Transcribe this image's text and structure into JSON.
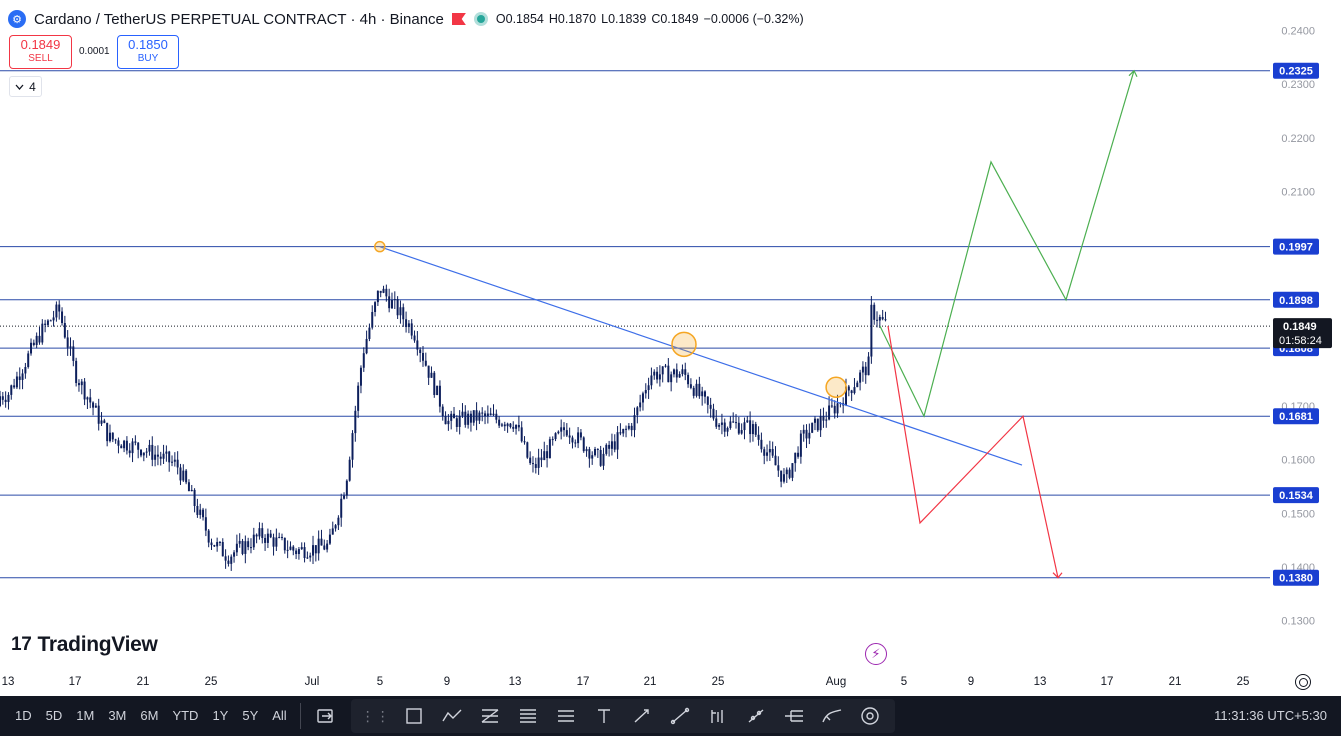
{
  "header": {
    "title": "Cardano / TetherUS PERPETUAL CONTRACT · 4h · Binance",
    "ohlc": {
      "open": "O0.1854",
      "high": "H0.1870",
      "low": "L0.1839",
      "close": "C0.1849",
      "change": "−0.0006 (−0.32%)"
    }
  },
  "trade": {
    "sell_price": "0.1849",
    "sell_label": "SELL",
    "spread": "0.0001",
    "buy_price": "0.1850",
    "buy_label": "BUY"
  },
  "indicators_count": "4",
  "branding": {
    "logo_text": "TradingView"
  },
  "bottom_bar": {
    "periods": [
      "1D",
      "5D",
      "1M",
      "3M",
      "6M",
      "YTD",
      "1Y",
      "5Y",
      "All"
    ],
    "clock": "11:31:36 UTC+5:30"
  },
  "icons": [
    "coin-icon",
    "flag-icon",
    "status-dot-icon",
    "chevron-down-icon",
    "bolt-icon",
    "axis-settings-icon"
  ],
  "colors": {
    "level_line": "#2a4aa8",
    "trend_line": "#3d6ee8",
    "bull_path": "#4caf50",
    "bear_path": "#f23645",
    "candle": "#0d1f5c",
    "price_tag": "#1a3fd1",
    "marker": "#f5a623"
  },
  "chart_data": {
    "type": "candlestick",
    "symbol": "ADAUSDT.P",
    "interval": "4h",
    "y_ticks": [
      "0.2400",
      "0.2300",
      "0.2200",
      "0.2100",
      "0.1900",
      "0.1700",
      "0.1600",
      "0.1500",
      "0.1400",
      "0.1300"
    ],
    "x_ticks": [
      "13",
      "17",
      "21",
      "25",
      "Jul",
      "5",
      "9",
      "13",
      "17",
      "21",
      "25",
      "Aug",
      "5",
      "9",
      "13",
      "17",
      "21",
      "25"
    ],
    "horizontal_levels": [
      "0.2325",
      "0.1997",
      "0.1898",
      "0.1808",
      "0.1681",
      "0.1534",
      "0.1380"
    ],
    "current_price": "0.1849",
    "countdown": "01:58:24",
    "ylim": [
      0.1262,
      0.2427
    ],
    "trendline": {
      "from": {
        "x": "Jul 5",
        "y": 0.1997
      },
      "to": {
        "x": "Aug 12",
        "y": 0.159
      }
    },
    "bullish_projection": [
      0.1849,
      0.1681,
      0.2155,
      0.1898,
      0.2325
    ],
    "bearish_projection": [
      0.1849,
      0.1482,
      0.1681,
      0.138
    ],
    "markers": [
      {
        "x": "Jul 5",
        "y": 0.1997
      },
      {
        "x": "Jul 23",
        "y": 0.1815
      },
      {
        "x": "Aug 1",
        "y": 0.1735
      }
    ],
    "price_path": [
      {
        "x": "Jun 10",
        "price": 0.17
      },
      {
        "x": "Jun 13",
        "price": 0.1722
      },
      {
        "x": "Jun 15",
        "price": 0.184
      },
      {
        "x": "Jun 16",
        "price": 0.188
      },
      {
        "x": "Jun 17",
        "price": 0.176
      },
      {
        "x": "Jun 19",
        "price": 0.164
      },
      {
        "x": "Jun 21",
        "price": 0.162
      },
      {
        "x": "Jun 23",
        "price": 0.159
      },
      {
        "x": "Jun 25",
        "price": 0.145
      },
      {
        "x": "Jun 26",
        "price": 0.142
      },
      {
        "x": "Jun 28",
        "price": 0.146
      },
      {
        "x": "Jun 30",
        "price": 0.143
      },
      {
        "x": "Jul 2",
        "price": 0.144
      },
      {
        "x": "Jul 3",
        "price": 0.156
      },
      {
        "x": "Jul 4",
        "price": 0.18
      },
      {
        "x": "Jul 5",
        "price": 0.192
      },
      {
        "x": "Jul 7",
        "price": 0.184
      },
      {
        "x": "Jul 9",
        "price": 0.167
      },
      {
        "x": "Jul 11",
        "price": 0.168
      },
      {
        "x": "Jul 13",
        "price": 0.167
      },
      {
        "x": "Jul 14",
        "price": 0.158
      },
      {
        "x": "Jul 16",
        "price": 0.166
      },
      {
        "x": "Jul 18",
        "price": 0.16
      },
      {
        "x": "Jul 20",
        "price": 0.167
      },
      {
        "x": "Jul 21",
        "price": 0.176
      },
      {
        "x": "Jul 23",
        "price": 0.176
      },
      {
        "x": "Jul 25",
        "price": 0.167
      },
      {
        "x": "Jul 27",
        "price": 0.166
      },
      {
        "x": "Jul 29",
        "price": 0.156
      },
      {
        "x": "Jul 30",
        "price": 0.164
      },
      {
        "x": "Aug 1",
        "price": 0.17
      },
      {
        "x": "Aug 3",
        "price": 0.178
      },
      {
        "x": "Aug 3",
        "price": 0.188
      },
      {
        "x": "Aug 4",
        "price": 0.1849
      }
    ]
  }
}
